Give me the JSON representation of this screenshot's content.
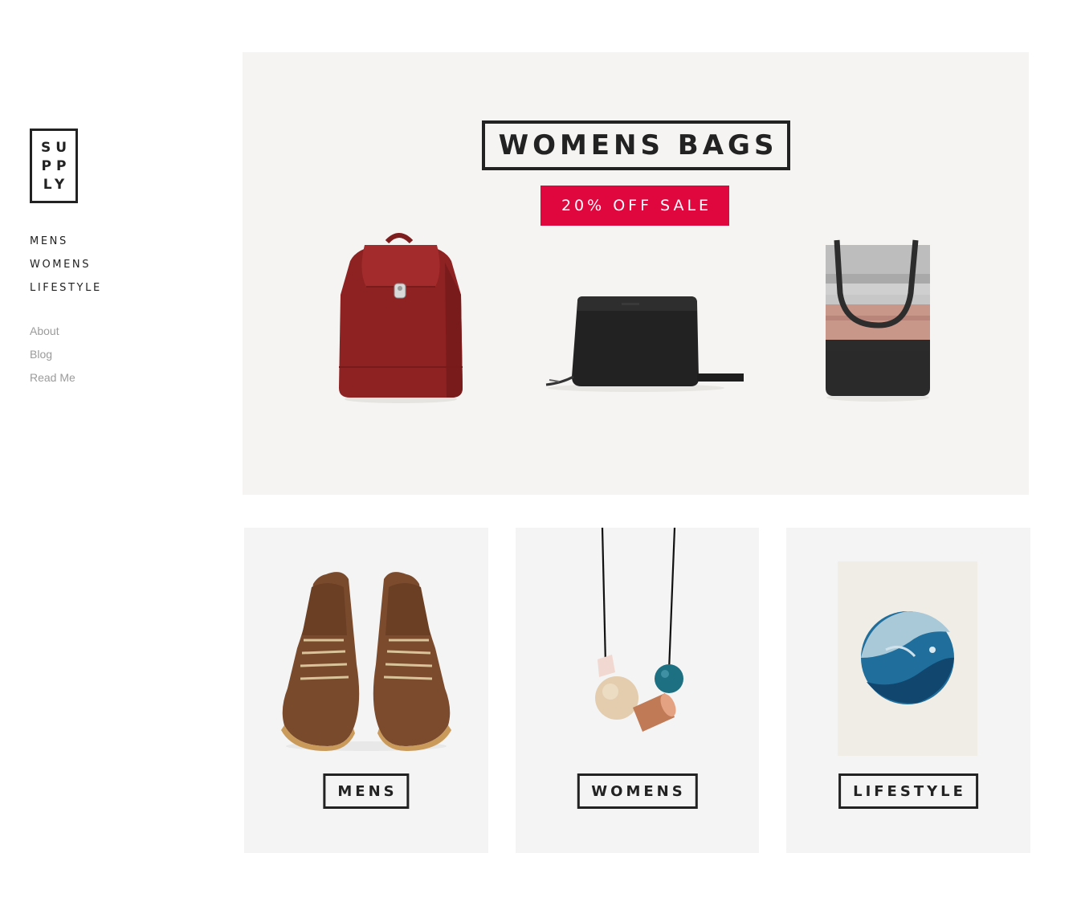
{
  "logo": {
    "line1": "SU",
    "line2": "PP",
    "line3": "LY"
  },
  "nav_primary": [
    {
      "label": "MENS"
    },
    {
      "label": "WOMENS"
    },
    {
      "label": "LIFESTYLE"
    }
  ],
  "nav_secondary": [
    {
      "label": "About"
    },
    {
      "label": "Blog"
    },
    {
      "label": "Read Me"
    }
  ],
  "hero": {
    "title": "WOMENS BAGS",
    "badge": "20% OFF SALE",
    "badge_color": "#e0073f"
  },
  "tiles": [
    {
      "label": "MENS"
    },
    {
      "label": "WOMENS"
    },
    {
      "label": "LIFESTYLE"
    }
  ]
}
